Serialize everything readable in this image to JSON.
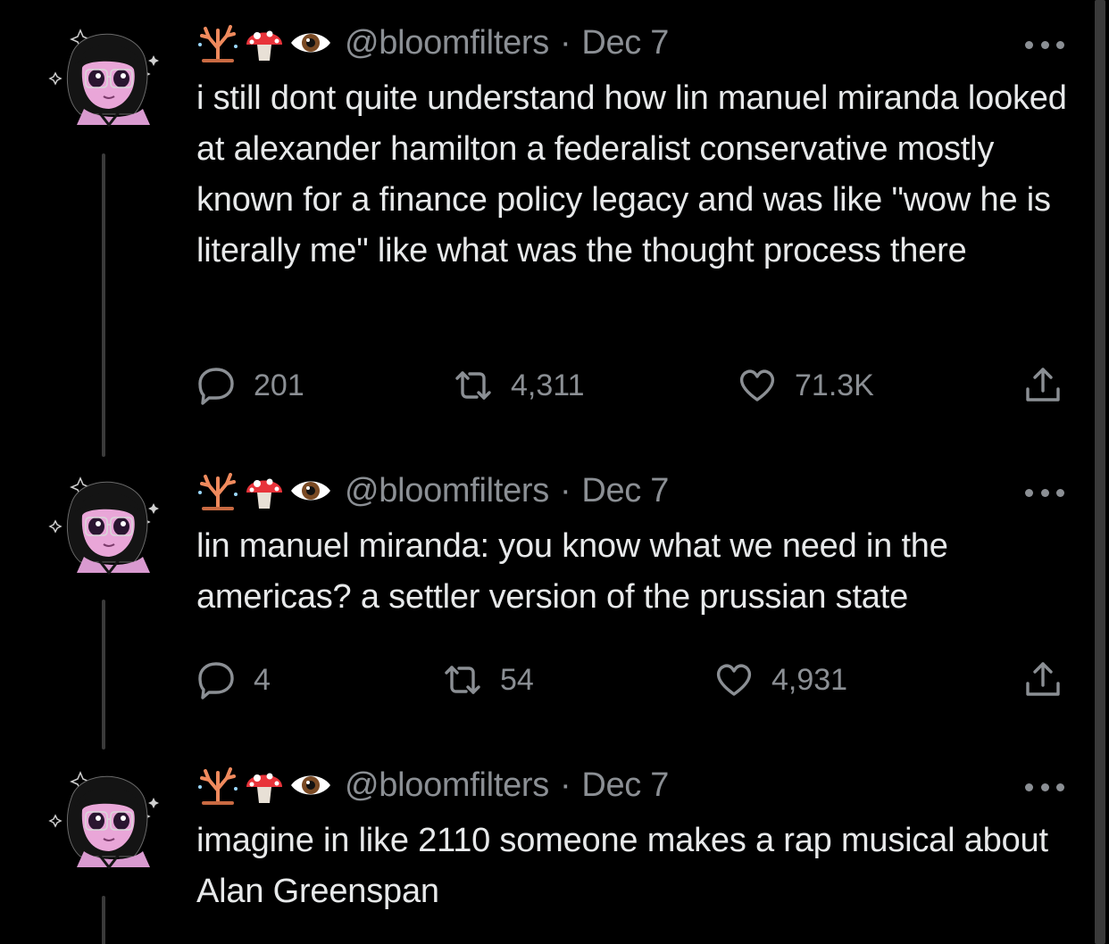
{
  "tweets": [
    {
      "handle": "@bloomfilters",
      "separator": "·",
      "date": "Dec 7",
      "text": "i still dont quite understand how lin manuel miranda looked at alexander hamilton a federalist conservative mostly known for a finance policy legacy and was like \"wow he is literally me\" like what was the thought process there",
      "replies": "201",
      "retweets": "4,311",
      "likes": "71.3K"
    },
    {
      "handle": "@bloomfilters",
      "separator": "·",
      "date": "Dec 7",
      "text": "lin manuel miranda: you know what we need in the americas? a settler version of the prussian state",
      "replies": "4",
      "retweets": "54",
      "likes": "4,931"
    },
    {
      "handle": "@bloomfilters",
      "separator": "·",
      "date": "Dec 7",
      "text": "imagine in like 2110 someone makes a rap musical about Alan Greenspan"
    }
  ],
  "name_emojis": [
    "coral-emoji",
    "mushroom-emoji",
    "eye-emoji"
  ],
  "colors": {
    "background": "#000000",
    "text": "#e7e9ea",
    "secondary": "#8b8f94",
    "thread_line": "#3a3a3a",
    "avatar_skin": "#e9a6d8",
    "avatar_hair": "#141414",
    "coral": "#f08a5d",
    "mushroom_cap": "#e8333a"
  }
}
